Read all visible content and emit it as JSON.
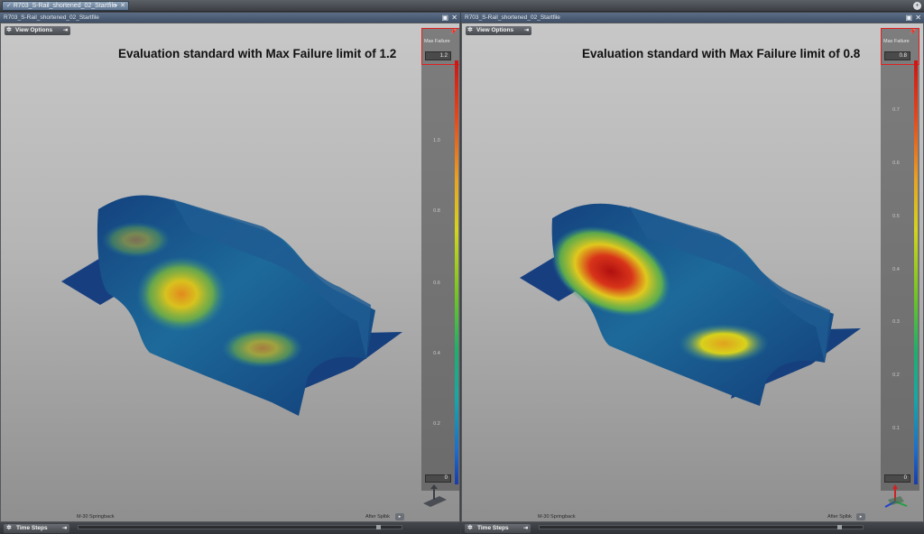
{
  "tabs": [
    {
      "label": "R703_S-Rail_shortened_02_Startfile",
      "active": true
    }
  ],
  "panes": [
    {
      "window_title": "R703_S-Rail_shortened_02_Startfile",
      "view_options_label": "View Options",
      "heading": "Evaluation standard with Max Failure limit of 1.2",
      "legend": {
        "name": "Max Failure",
        "max_value": "1.2",
        "min_value": "0",
        "ticks": [
          "1.0",
          "0.8",
          "0.6",
          "0.4",
          "0.2"
        ]
      },
      "time_steps_label": "Time Steps",
      "step_start_label": "M-30 Springback",
      "step_end_label": "After Splbk"
    },
    {
      "window_title": "R703_S-Rail_shortened_02_Startfile",
      "view_options_label": "View Options",
      "heading": "Evaluation standard with Max Failure limit of 0.8",
      "legend": {
        "name": "Max Failure",
        "max_value": "0.8",
        "min_value": "0",
        "ticks": [
          "0.7",
          "0.6",
          "0.5",
          "0.4",
          "0.3",
          "0.2",
          "0.1"
        ]
      },
      "time_steps_label": "Time Steps",
      "step_start_label": "M-30 Springback",
      "step_end_label": "After Splbk"
    }
  ],
  "colors": {
    "legend_highlight": "#e02020",
    "failure_high": "#c41a14",
    "failure_mid": "#d8d21c",
    "failure_low": "#153f7d"
  },
  "icons": [
    "check-icon",
    "dropdown-icon",
    "close-icon",
    "gear-icon",
    "maximize-icon",
    "pin-icon",
    "arrow-icon",
    "axis-triad-icon"
  ]
}
